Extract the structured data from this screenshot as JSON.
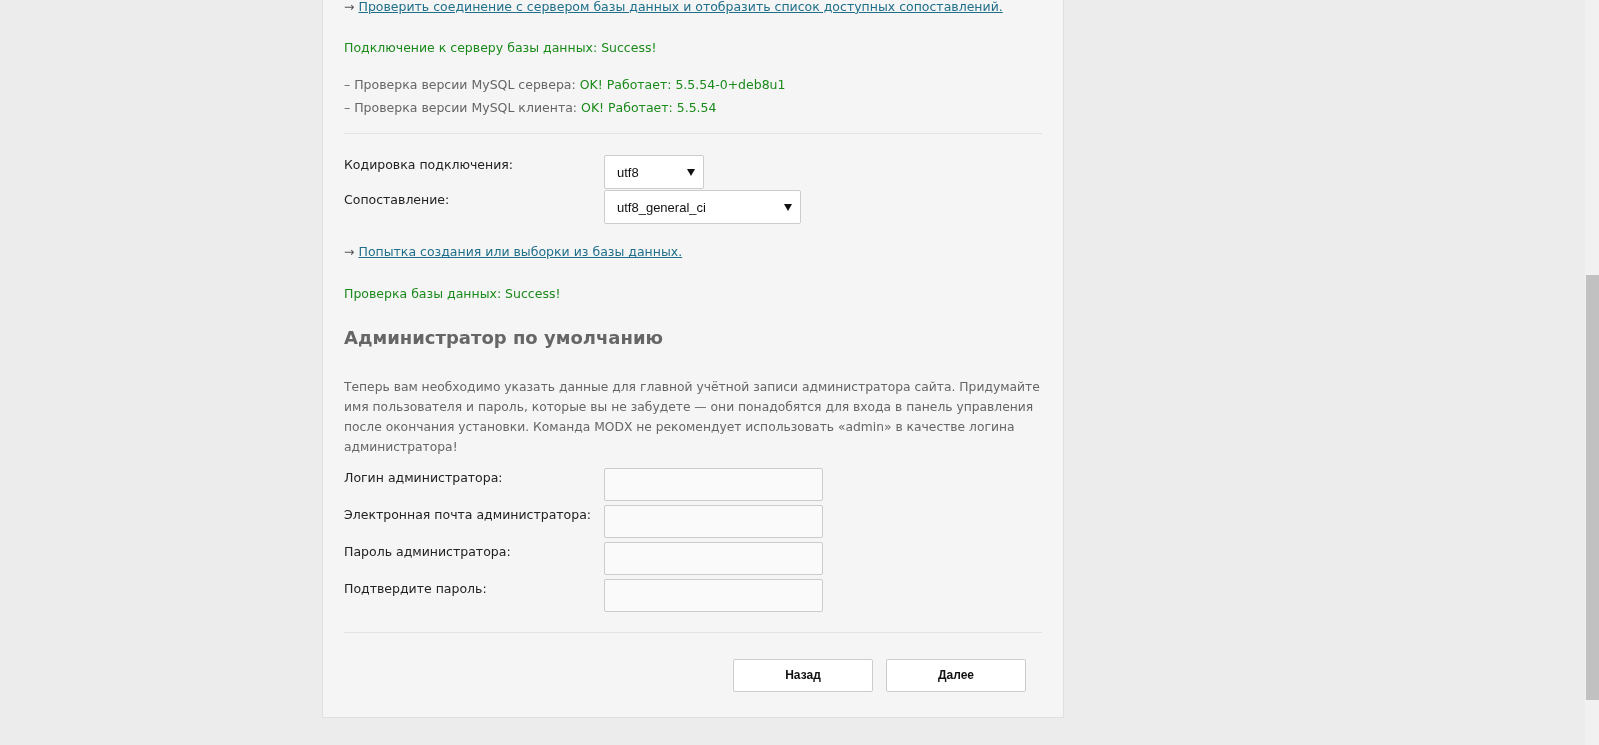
{
  "db_check": {
    "arrow": "→",
    "link": "Проверить соединение с сервером базы данных и отобразить список доступных сопоставлений.",
    "status": "Подключение к серверу базы данных: Success!",
    "versions": [
      {
        "label": "– Проверка версии MySQL сервера:",
        "result": "OK! Работает: 5.5.54-0+deb8u1"
      },
      {
        "label": "– Проверка версии MySQL клиента:",
        "result": "OK! Работает: 5.5.54"
      }
    ]
  },
  "encoding": [
    {
      "label": "Кодировка подключения:",
      "value": "utf8"
    },
    {
      "label": "Сопоставление:",
      "value": "utf8_general_ci"
    }
  ],
  "db_create": {
    "arrow": "→",
    "link": "Попытка создания или выборки из базы данных.",
    "status": "Проверка базы данных: Success!"
  },
  "admin": {
    "heading": "Администратор по умолчанию",
    "intro": "Теперь вам необходимо указать данные для главной учётной записи администратора сайта. Придумайте имя пользователя и пароль, которые вы не забудете — они понадобятся для входа в панель управления после окончания установки. Команда MODX не рекомендует использовать «admin» в качестве логина администратора!",
    "fields": [
      {
        "label": "Логин администратора:"
      },
      {
        "label": "Электронная почта администратора:"
      },
      {
        "label": "Пароль администратора:"
      },
      {
        "label": "Подтвердите пароль:"
      }
    ]
  },
  "buttons": [
    "Назад",
    "Далее"
  ]
}
